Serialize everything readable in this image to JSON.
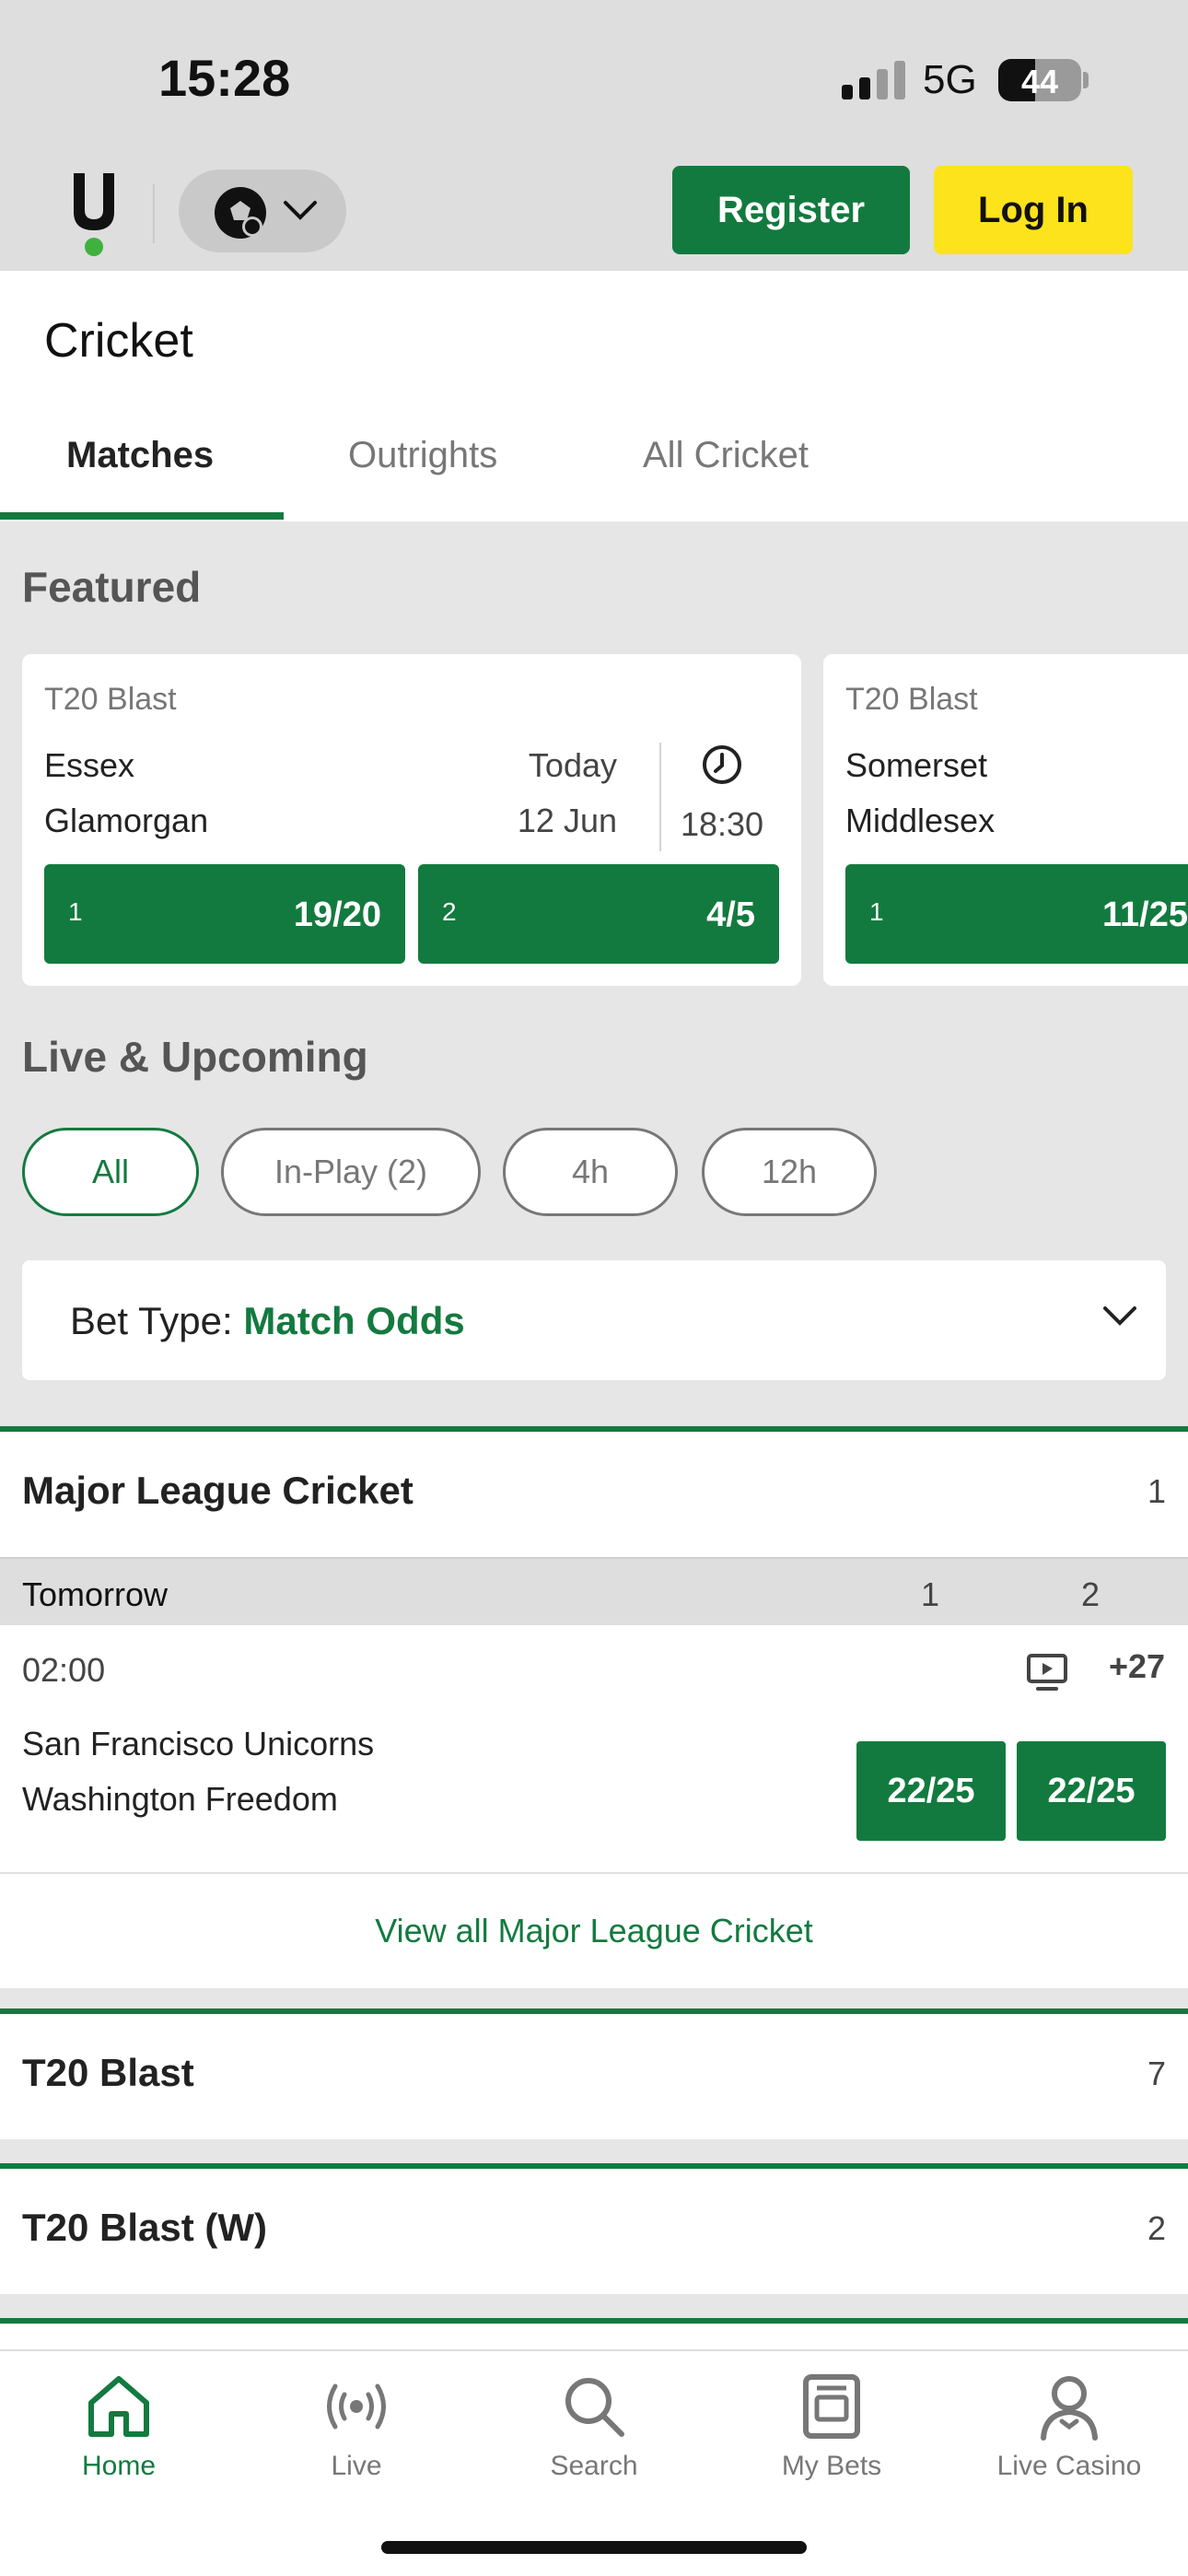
{
  "status": {
    "time": "15:28",
    "network": "5G",
    "battery": "44"
  },
  "header": {
    "register_label": "Register",
    "login_label": "Log In",
    "sport_icon": "football-icon"
  },
  "page": {
    "title": "Cricket",
    "tabs": [
      {
        "label": "Matches",
        "active": true
      },
      {
        "label": "Outrights",
        "active": false
      },
      {
        "label": "All Cricket",
        "active": false
      }
    ]
  },
  "featured": {
    "heading": "Featured",
    "cards": [
      {
        "competition": "T20 Blast",
        "team1": "Essex",
        "team2": "Glamorgan",
        "date_top": "Today",
        "date_bottom": "12 Jun",
        "time": "18:30",
        "odds": [
          {
            "sel": "1",
            "price": "19/20"
          },
          {
            "sel": "2",
            "price": "4/5"
          }
        ]
      },
      {
        "competition": "T20 Blast",
        "team1": "Somerset",
        "team2": "Middlesex",
        "odds": [
          {
            "sel": "1",
            "price": "11/25"
          }
        ]
      }
    ]
  },
  "live": {
    "heading": "Live & Upcoming",
    "filters": [
      {
        "label": "All",
        "active": true
      },
      {
        "label": "In-Play (2)",
        "active": false
      },
      {
        "label": "4h",
        "active": false
      },
      {
        "label": "12h",
        "active": false
      }
    ],
    "bet_type_label": "Bet Type:",
    "bet_type_value": "Match Odds"
  },
  "leagues": [
    {
      "name": "Major League Cricket",
      "count": "1"
    },
    {
      "name": "T20 Blast",
      "count": "7"
    },
    {
      "name": "T20 Blast (W)",
      "count": "2"
    }
  ],
  "mlc": {
    "day": "Tomorrow",
    "col1": "1",
    "col2": "2",
    "match": {
      "time": "02:00",
      "more_markets": "+27",
      "team1": "San Francisco Unicorns",
      "team2": "Washington Freedom",
      "odds1": "22/25",
      "odds2": "22/25"
    },
    "view_all": "View all Major League Cricket"
  },
  "tabbar": [
    {
      "label": "Home",
      "icon": "home-icon",
      "active": true
    },
    {
      "label": "Live",
      "icon": "live-icon",
      "active": false
    },
    {
      "label": "Search",
      "icon": "search-icon",
      "active": false
    },
    {
      "label": "My Bets",
      "icon": "my-bets-icon",
      "active": false
    },
    {
      "label": "Live Casino",
      "icon": "live-casino-icon",
      "active": false
    }
  ],
  "colors": {
    "brand_green": "#137a3f",
    "login_yellow": "#fce31c"
  }
}
